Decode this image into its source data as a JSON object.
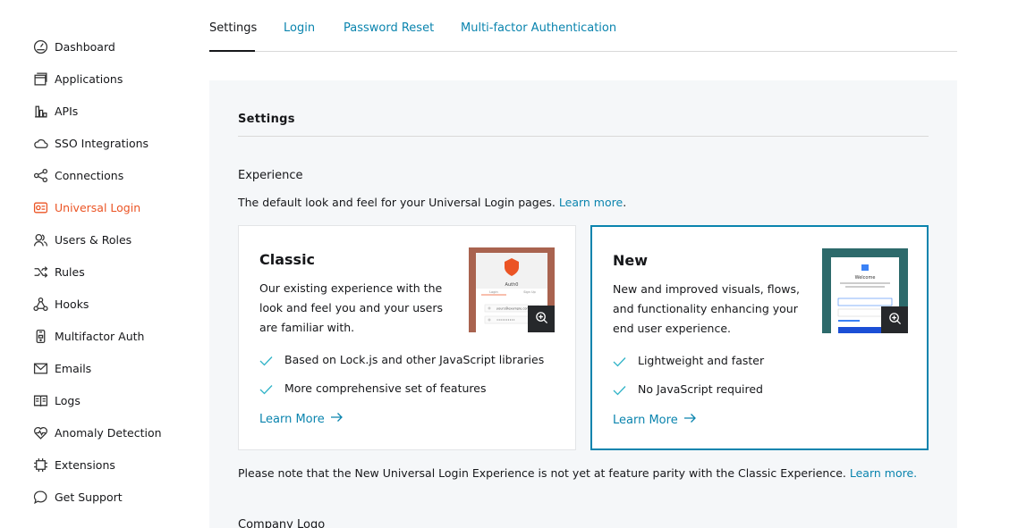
{
  "sidebar": {
    "items": [
      {
        "label": "Dashboard",
        "icon": "dashboard-icon"
      },
      {
        "label": "Applications",
        "icon": "applications-icon"
      },
      {
        "label": "APIs",
        "icon": "apis-icon"
      },
      {
        "label": "SSO Integrations",
        "icon": "cloud-icon"
      },
      {
        "label": "Connections",
        "icon": "connections-icon"
      },
      {
        "label": "Universal Login",
        "icon": "universal-login-icon",
        "active": true
      },
      {
        "label": "Users & Roles",
        "icon": "users-icon"
      },
      {
        "label": "Rules",
        "icon": "rules-icon"
      },
      {
        "label": "Hooks",
        "icon": "hooks-icon"
      },
      {
        "label": "Multifactor Auth",
        "icon": "phone-icon"
      },
      {
        "label": "Emails",
        "icon": "mail-icon"
      },
      {
        "label": "Logs",
        "icon": "logs-icon"
      },
      {
        "label": "Anomaly Detection",
        "icon": "heart-icon"
      },
      {
        "label": "Extensions",
        "icon": "chip-icon"
      },
      {
        "label": "Get Support",
        "icon": "chat-icon"
      }
    ]
  },
  "tabs": [
    {
      "label": "Settings",
      "active": true
    },
    {
      "label": "Login"
    },
    {
      "label": "Password Reset"
    },
    {
      "label": "Multi-factor Authentication"
    }
  ],
  "panel": {
    "title": "Settings",
    "experience": {
      "title": "Experience",
      "description": "The default look and feel for your Universal Login pages. ",
      "description_link": "Learn more",
      "description_end": "."
    },
    "cards": {
      "classic": {
        "title": "Classic",
        "description": "Our existing experience with the look and feel you and your users are familiar with.",
        "features": [
          "Based on Lock.js and other JavaScript libraries",
          "More comprehensive set of features"
        ],
        "learn_more": "Learn More",
        "thumb_brand": "Auth0",
        "thumb_tabs": [
          "Login",
          "Sign Up"
        ],
        "thumb_email": "yours@example.com",
        "thumb_password": "••••••••••"
      },
      "new": {
        "title": "New",
        "description": "New and improved visuals, flows, and functionality enhancing your end user experience.",
        "features": [
          "Lightweight and faster",
          "No JavaScript required"
        ],
        "learn_more": "Learn More",
        "thumb_welcome": "Welcome",
        "selected": true
      }
    },
    "note": "Please note that the New Universal Login Experience is not yet at feature parity with the Classic Experience. ",
    "note_link": "Learn more.",
    "company_logo_title": "Company Logo"
  },
  "colors": {
    "accent": "#0a84ae",
    "active_nav": "#eb5424",
    "check": "#2fb3c7",
    "panel_bg": "#f5f7f9"
  }
}
